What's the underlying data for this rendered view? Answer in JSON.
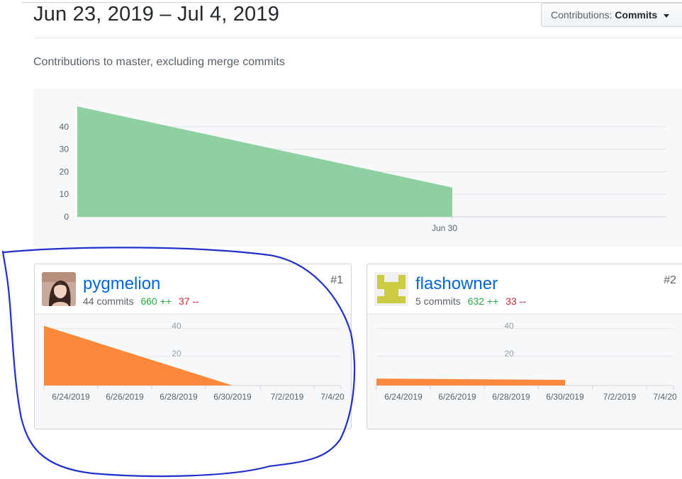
{
  "header": {
    "date_range": "Jun 23, 2019 – Jul 4, 2019",
    "contributions_prefix": "Contributions:",
    "contributions_value": "Commits",
    "subtitle": "Contributions to master, excluding merge commits"
  },
  "colors": {
    "main_area": "#8fd0a0",
    "contributor_area": "#f9883a",
    "link": "#0366d6",
    "additions": "#28a745",
    "deletions": "#cb2431",
    "annotation": "#1f2fc9"
  },
  "chart_data": [
    {
      "type": "area",
      "title": "",
      "x": [
        "Jun 23",
        "Jun 30"
      ],
      "values": [
        49,
        13
      ],
      "y_ticks": [
        0,
        10,
        20,
        30,
        40
      ],
      "x_tick_labels": [
        "Jun 30"
      ],
      "ylim": [
        0,
        50
      ],
      "grid": true,
      "color": "#8fd0a0"
    },
    {
      "type": "area",
      "title": "",
      "x": [
        "6/23/2019",
        "6/30/2019"
      ],
      "values": [
        43,
        0
      ],
      "y_ticks": [
        20,
        40
      ],
      "x_tick_labels": [
        "6/24/2019",
        "6/26/2019",
        "6/28/2019",
        "6/30/2019",
        "7/2/2019",
        "7/4/20"
      ],
      "ylim": [
        0,
        45
      ],
      "grid": true,
      "color": "#f9883a"
    },
    {
      "type": "area",
      "title": "",
      "x": [
        "6/23/2019",
        "6/30/2019"
      ],
      "values": [
        5,
        4
      ],
      "y_ticks": [
        20,
        40
      ],
      "x_tick_labels": [
        "6/24/2019",
        "6/26/2019",
        "6/28/2019",
        "6/30/2019",
        "7/2/2019",
        "7/4/20"
      ],
      "ylim": [
        0,
        45
      ],
      "grid": true,
      "color": "#f9883a"
    }
  ],
  "contributors": [
    {
      "username": "pygmelion",
      "commits": "44 commits",
      "additions": "660 ++",
      "deletions": "37 --",
      "rank": "#1",
      "avatar_icon": "photo-avatar"
    },
    {
      "username": "flashowner",
      "commits": "5 commits",
      "additions": "632 ++",
      "deletions": "33 --",
      "rank": "#2",
      "avatar_icon": "identicon-avatar"
    }
  ]
}
